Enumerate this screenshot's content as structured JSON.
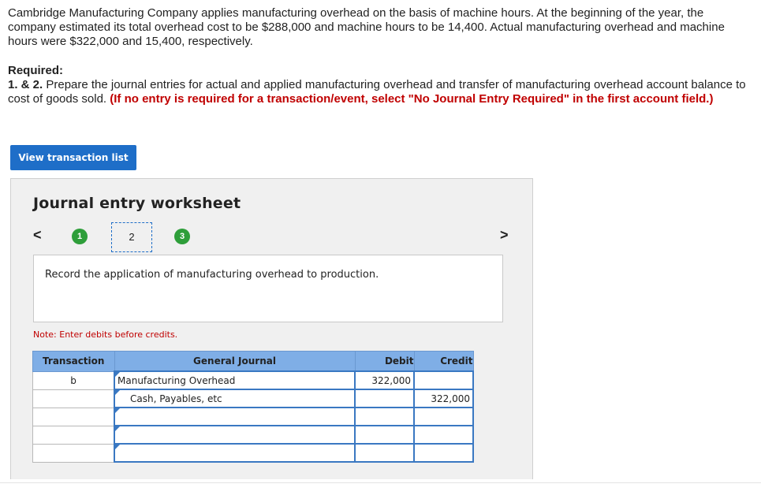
{
  "problem": {
    "intro": "Cambridge Manufacturing Company applies manufacturing overhead on the basis of machine hours. At the beginning of the year, the company estimated its total overhead cost to be $288,000 and machine hours to be 14,400. Actual manufacturing overhead and machine hours were $322,000 and 15,400, respectively.",
    "required_title": "Required:",
    "required_num": "1. & 2.",
    "required_text": " Prepare the journal entries for actual and applied manufacturing overhead and transfer of manufacturing overhead account balance to cost of goods sold. ",
    "required_red": "(If no entry is required for a transaction/event, select \"No Journal Entry Required\" in the first account field.)"
  },
  "view_button": "View transaction list",
  "worksheet": {
    "title": "Journal entry worksheet",
    "prev": "<",
    "next": ">",
    "steps": [
      "1",
      "2",
      "3"
    ],
    "prompt": "Record the application of manufacturing overhead to production.",
    "note": "Note: Enter debits before credits."
  },
  "table": {
    "headers": [
      "Transaction",
      "General Journal",
      "Debit",
      "Credit"
    ],
    "rows": [
      {
        "transaction": "b",
        "account": "Manufacturing Overhead",
        "debit": "322,000",
        "credit": ""
      },
      {
        "transaction": "",
        "account": "Cash, Payables, etc",
        "debit": "",
        "credit": "322,000"
      },
      {
        "transaction": "",
        "account": "",
        "debit": "",
        "credit": ""
      },
      {
        "transaction": "",
        "account": "",
        "debit": "",
        "credit": ""
      },
      {
        "transaction": "",
        "account": "",
        "debit": "",
        "credit": ""
      },
      {
        "transaction": "",
        "account": "",
        "debit": "",
        "credit": ""
      }
    ]
  }
}
